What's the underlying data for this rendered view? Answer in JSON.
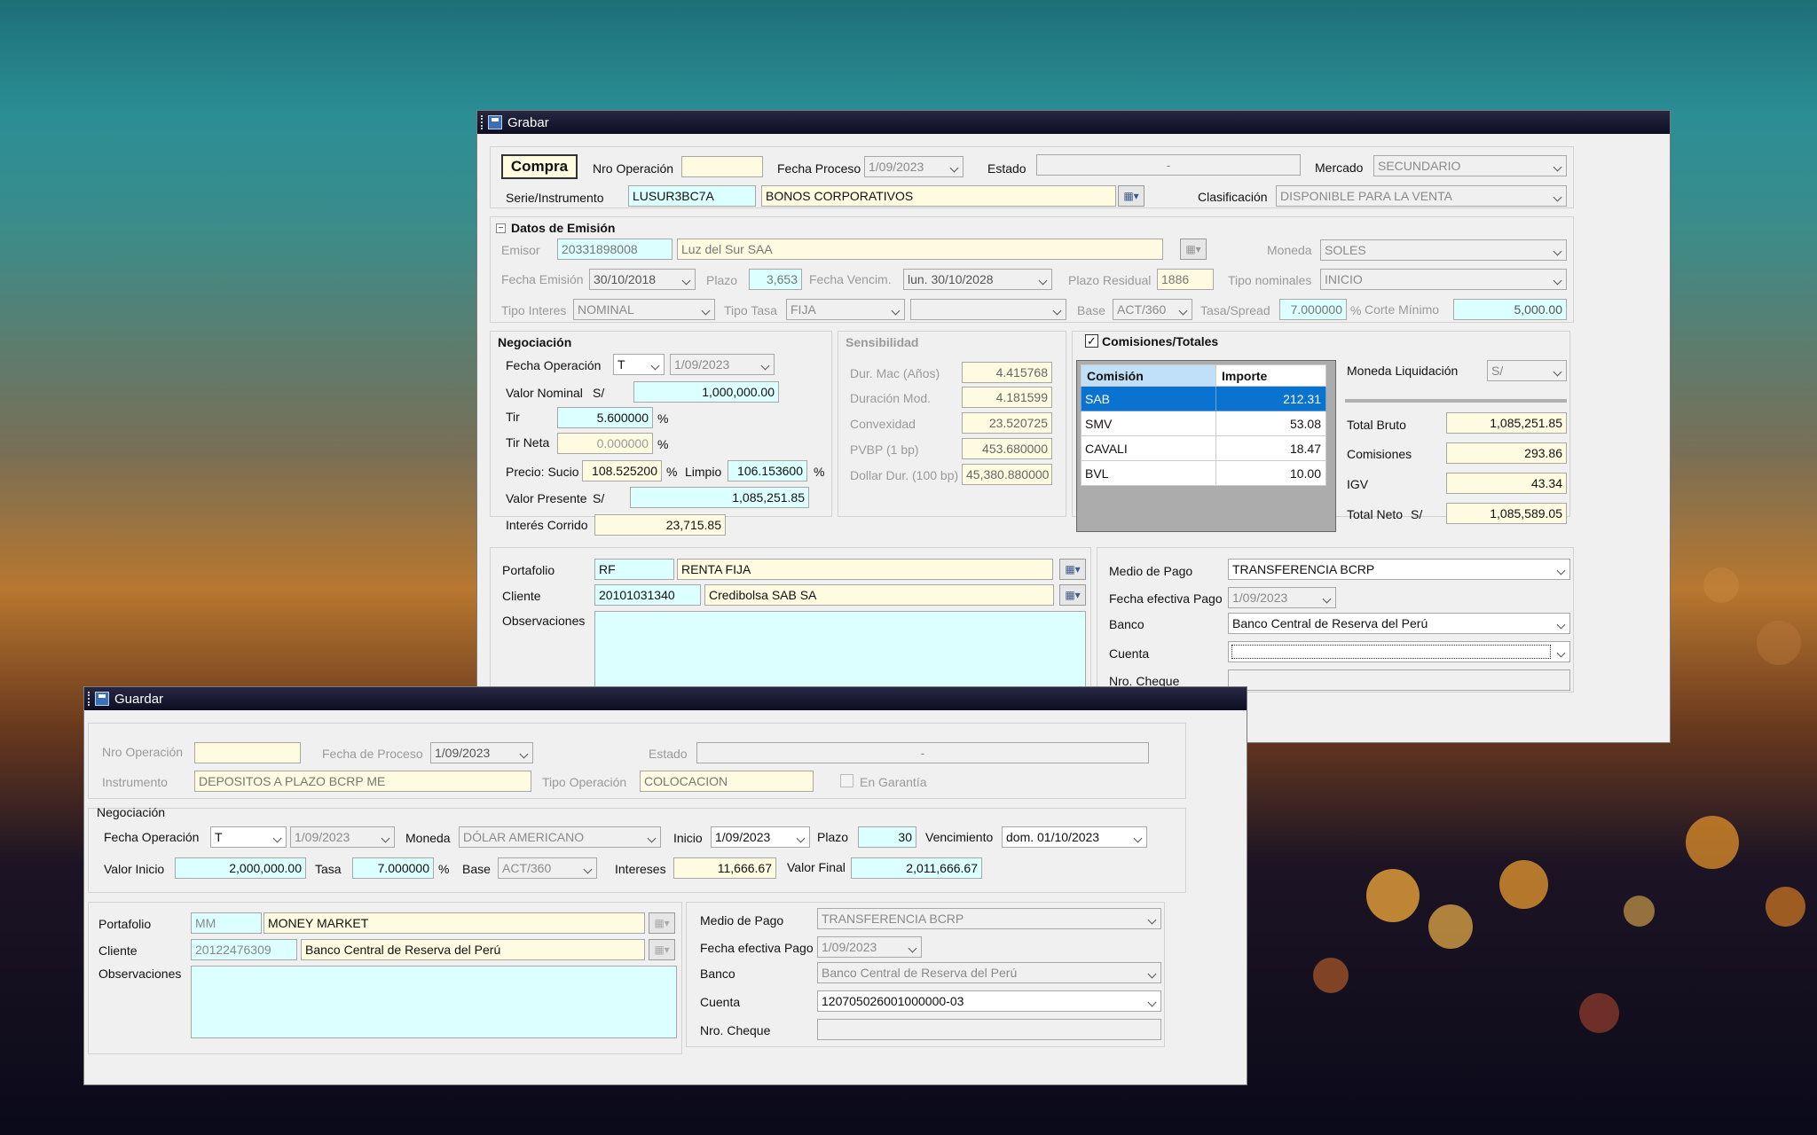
{
  "colors": {
    "accent": "#0a73d0",
    "field_cyan": "#dcffff",
    "field_yellow": "#fffbe0",
    "titlebar": "#17172e"
  },
  "grabar": {
    "title": "Grabar",
    "tipo": "Compra",
    "nro_operacion_label": "Nro Operación",
    "nro_operacion": "",
    "fecha_proceso_label": "Fecha Proceso",
    "fecha_proceso": "1/09/2023",
    "estado_label": "Estado",
    "estado": "-",
    "mercado_label": "Mercado",
    "mercado": "SECUNDARIO",
    "serie_label": "Serie/Instrumento",
    "serie_code": "LUSUR3BC7A",
    "serie_name": "BONOS CORPORATIVOS",
    "clasificacion_label": "Clasificación",
    "clasificacion": "DISPONIBLE PARA LA VENTA",
    "emision": {
      "title": "Datos de Emisión",
      "emisor_label": "Emisor",
      "emisor_code": "20331898008",
      "emisor_name": "Luz del Sur SAA",
      "moneda_label": "Moneda",
      "moneda": "SOLES",
      "fecha_emision_label": "Fecha  Emisión",
      "fecha_emision": "30/10/2018",
      "plazo_label": "Plazo",
      "plazo": "3,653",
      "fecha_venc_label": "Fecha  Vencim.",
      "fecha_venc": "lun.  30/10/2028",
      "plazo_residual_label": "Plazo Residual",
      "plazo_residual": "1886",
      "tipo_nominales_label": "Tipo nominales",
      "tipo_nominales": "INICIO",
      "tipo_interes_label": "Tipo Interes",
      "tipo_interes": "NOMINAL",
      "tipo_tasa_label": "Tipo Tasa",
      "tipo_tasa": "FIJA",
      "tipo_tasa2": "",
      "base_label": "Base",
      "base": "ACT/360",
      "tasa_spread_label": "Tasa/Spread",
      "tasa_spread": "7.000000",
      "pct": "%",
      "corte_label": "Corte Mínimo",
      "corte": "5,000.00"
    },
    "negociacion": {
      "title": "Negociación",
      "fecha_op_label": "Fecha Operación",
      "fecha_op_tipo": "T",
      "fecha_op": "1/09/2023",
      "valor_nominal_label": "Valor Nominal",
      "currency": "S/",
      "valor_nominal": "1,000,000.00",
      "tir_label": "Tir",
      "tir": "5.600000",
      "tir_neta_label": "Tir Neta",
      "tir_neta": "0.000000",
      "pct": "%",
      "precio_label": "Precio: Sucio",
      "precio_sucio": "108.525200",
      "limpio_label": "Limpio",
      "precio_limpio": "106.153600",
      "valor_presente_label": "Valor Presente",
      "valor_presente": "1,085,251.85",
      "interes_label": "Interés Corrido",
      "interes": "23,715.85"
    },
    "sensibilidad": {
      "title": "Sensibilidad",
      "items": [
        {
          "label": "Dur. Mac (Años)",
          "value": "4.415768"
        },
        {
          "label": "Duración Mod.",
          "value": "4.181599"
        },
        {
          "label": "Convexidad",
          "value": "23.520725"
        },
        {
          "label": "PVBP (1 bp)",
          "value": "453.680000"
        },
        {
          "label": "Dollar Dur. (100 bp)",
          "value": "45,380.880000"
        }
      ]
    },
    "comisiones": {
      "title": "Comisiones/Totales",
      "col_comision": "Comisión",
      "col_importe": "Importe",
      "rows": [
        {
          "name": "SAB",
          "value": "212.31"
        },
        {
          "name": "SMV",
          "value": "53.08"
        },
        {
          "name": "CAVALI",
          "value": "18.47"
        },
        {
          "name": "BVL",
          "value": "10.00"
        }
      ],
      "moneda_liq_label": "Moneda Liquidación",
      "moneda_liq": "S/",
      "total_bruto_label": "Total Bruto",
      "total_bruto": "1,085,251.85",
      "comisiones_label": "Comisiones",
      "comisiones": "293.86",
      "igv_label": "IGV",
      "igv": "43.34",
      "total_neto_label": "Total Neto",
      "total_neto_cur": "S/",
      "total_neto": "1,085,589.05"
    },
    "portafolio_label": "Portafolio",
    "portafolio_code": "RF",
    "portafolio_name": "RENTA FIJA",
    "cliente_label": "Cliente",
    "cliente_code": "20101031340",
    "cliente_name": "Credibolsa SAB SA",
    "observaciones_label": "Observaciones",
    "medio_pago_label": "Medio de Pago",
    "medio_pago": "TRANSFERENCIA BCRP",
    "fecha_pago_label": "Fecha efectiva Pago",
    "fecha_pago": "1/09/2023",
    "banco_label": "Banco",
    "banco": "Banco Central de Reserva del Perú",
    "cuenta_label": "Cuenta",
    "cuenta": "",
    "cheque_label": "Nro. Cheque"
  },
  "guardar": {
    "title": "Guardar",
    "nro_operacion_label": "Nro Operación",
    "nro_operacion": "",
    "fecha_proceso_label": "Fecha de Proceso",
    "fecha_proceso": "1/09/2023",
    "estado_label": "Estado",
    "estado": "-",
    "instrumento_label": "Instrumento",
    "instrumento": "DEPOSITOS A PLAZO BCRP ME",
    "tipo_op_label": "Tipo Operación",
    "tipo_op": "COLOCACION",
    "garantia_label": "En Garantía",
    "neg_title": "Negociación",
    "fecha_op_label": "Fecha Operación",
    "fecha_op_tipo": "T",
    "fecha_op": "1/09/2023",
    "moneda_label": "Moneda",
    "moneda": "DÓLAR AMERICANO",
    "inicio_label": "Inicio",
    "inicio": "1/09/2023",
    "plazo_label": "Plazo",
    "plazo": "30",
    "venc_label": "Vencimiento",
    "venc": "dom.  01/10/2023",
    "valor_inicio_label": "Valor Inicio",
    "valor_inicio": "2,000,000.00",
    "tasa_label": "Tasa",
    "tasa": "7.000000",
    "pct": "%",
    "base_label": "Base",
    "base": "ACT/360",
    "intereses_label": "Intereses",
    "intereses": "11,666.67",
    "valor_final_label": "Valor Final",
    "valor_final": "2,011,666.67",
    "portafolio_label": "Portafolio",
    "portafolio_code": "MM",
    "portafolio_name": "MONEY MARKET",
    "cliente_label": "Cliente",
    "cliente_code": "20122476309",
    "cliente_name": "Banco Central de Reserva del Perú",
    "observaciones_label": "Observaciones",
    "medio_pago_label": "Medio de Pago",
    "medio_pago": "TRANSFERENCIA BCRP",
    "fecha_pago_label": "Fecha efectiva Pago",
    "fecha_pago": "1/09/2023",
    "banco_label": "Banco",
    "banco": "Banco Central de Reserva del Perú",
    "cuenta_label": "Cuenta",
    "cuenta": "120705026001000000-03",
    "cheque_label": "Nro. Cheque"
  }
}
